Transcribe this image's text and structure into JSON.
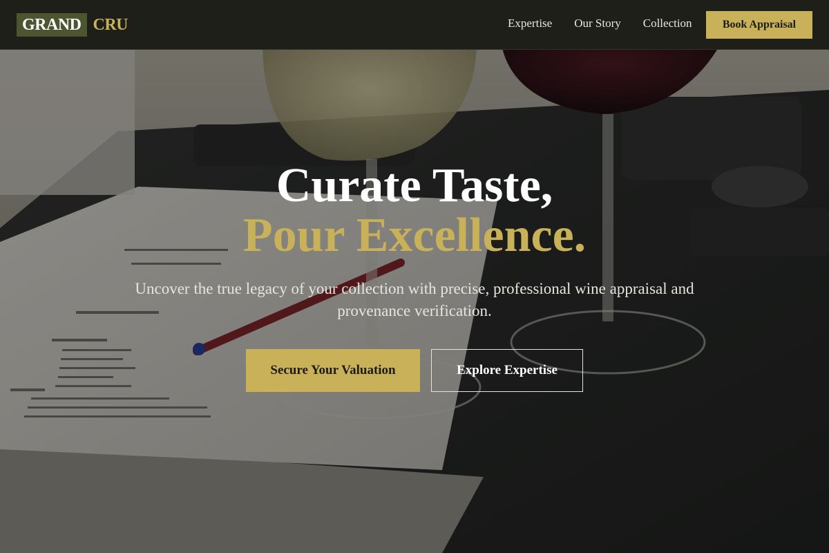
{
  "brand": {
    "logo_part1": "GRAND",
    "logo_part2": "CRU"
  },
  "nav": {
    "links": [
      "Expertise",
      "Our Story",
      "Collection"
    ],
    "cta_label": "Book Appraisal"
  },
  "hero": {
    "headline_line1": "Curate Taste,",
    "headline_line2": "Pour Excellence.",
    "subtitle": "Uncover the true legacy of your collection with precise, professional wine appraisal and provenance verification.",
    "primary_cta": "Secure Your Valuation",
    "secondary_cta": "Explore Expertise",
    "background_image": "hero-wine-glasses-photo"
  },
  "colors": {
    "accent_gold": "#c9b15a",
    "logo_green": "#4d5530",
    "nav_background": "#1f1f1a",
    "headline_white": "#ffffff"
  }
}
